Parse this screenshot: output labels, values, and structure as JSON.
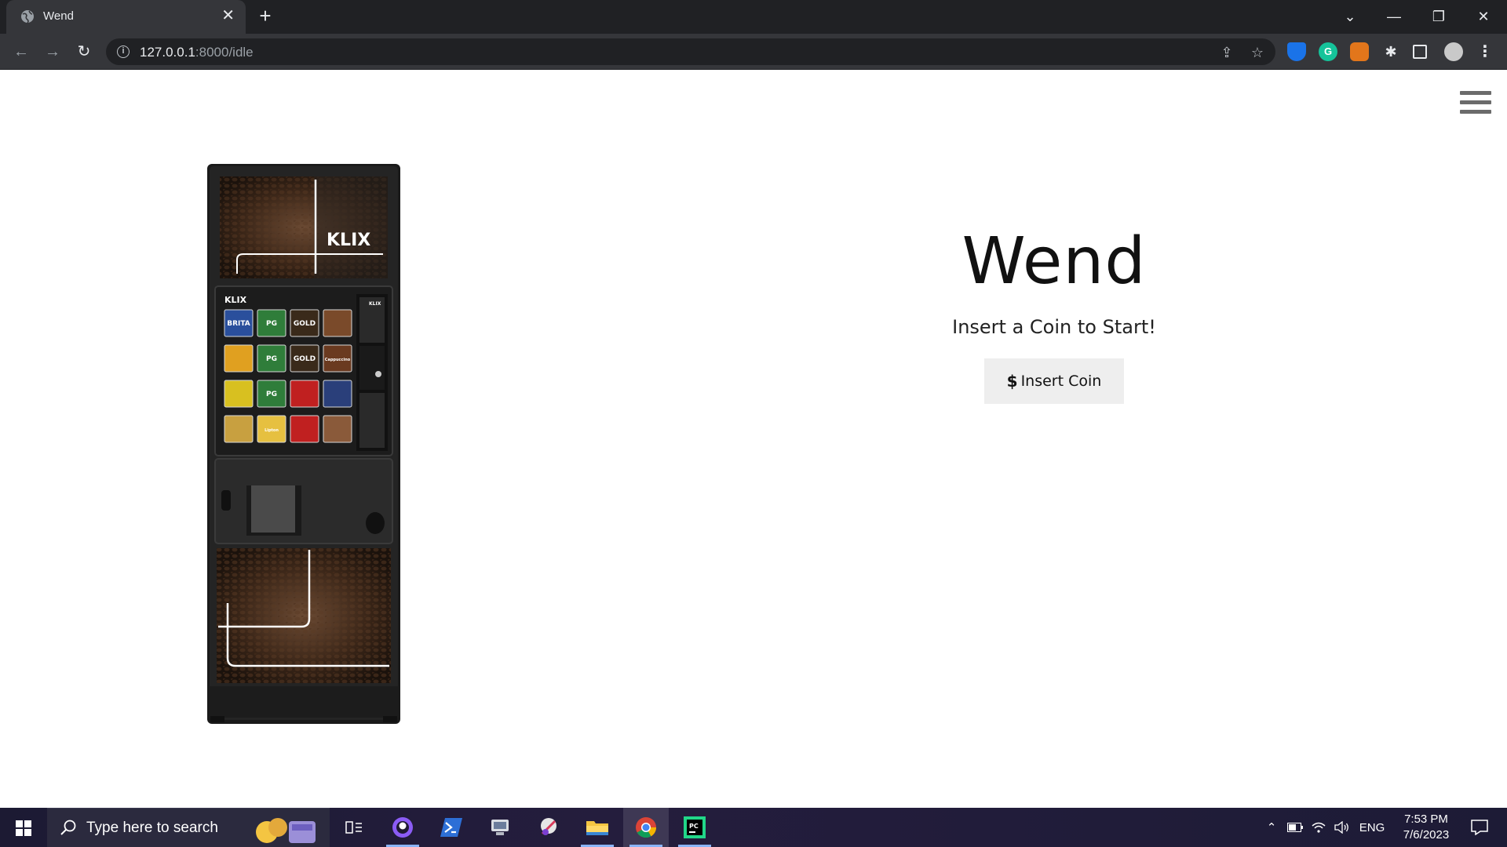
{
  "browser": {
    "tab_title": "Wend",
    "tab_close": "✕",
    "new_tab": "+",
    "url_host": "127.0.0.1",
    "url_path": ":8000/idle"
  },
  "page": {
    "title": "Wend",
    "subtitle": "Insert a Coin to Start!",
    "button": {
      "icon": "$",
      "label": "Insert Coin"
    },
    "image": {
      "brand_top": "KLIX",
      "brand_panel": "KLIX",
      "brand_small": "KLIX",
      "product_labels": [
        "BRITA",
        "PG",
        "GOLD",
        "",
        "",
        "PG",
        "GOLD",
        "Cappuccino",
        "",
        "PG",
        "",
        "",
        "",
        "Lipton",
        "",
        ""
      ]
    }
  },
  "taskbar": {
    "search_placeholder": "Type here to search",
    "language": "ENG",
    "time": "7:53 PM",
    "date": "7/6/2023",
    "pycharm_label": "PC"
  },
  "colors": {
    "tab_bg": "#35363a",
    "toolbar_bg": "#35363a",
    "button_bg": "#eeeeee",
    "hamburger": "#6b6b6b"
  }
}
